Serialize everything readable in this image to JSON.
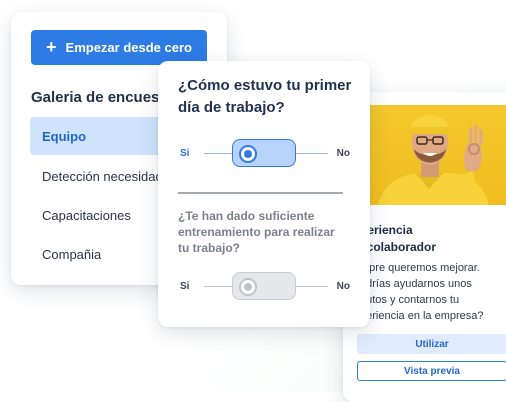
{
  "gallery": {
    "start_button": "Empezar desde cero",
    "title": "Galeria de encuestas",
    "items": [
      {
        "label": "Equipo"
      },
      {
        "label": "Detección necesidades"
      },
      {
        "label": "Capacitaciones"
      },
      {
        "label": "Compañia"
      }
    ]
  },
  "question_card": {
    "question1": "¿Cómo estuvo tu primer día de trabajo?",
    "question2": "¿Te han dado suficiente entrenamiento para realizar tu trabajo?",
    "slider1": {
      "left_label": "Si",
      "right_label": "No"
    },
    "slider2": {
      "left_label": "Si",
      "right_label": "No"
    }
  },
  "template_card": {
    "title_line1": "periencia",
    "title_line2": "l colaborador",
    "desc_lines": [
      "mpre queremos mejorar.",
      "odrías ayudarnos unos",
      "nutos y contarnos tu",
      "periencia en la empresa?"
    ],
    "use_button": "Utilizar",
    "preview_button": "Vista previa"
  },
  "colors": {
    "accent": "#2d7be5",
    "active_bg": "#cfe3fb",
    "photo_bg": "#f2c324"
  }
}
